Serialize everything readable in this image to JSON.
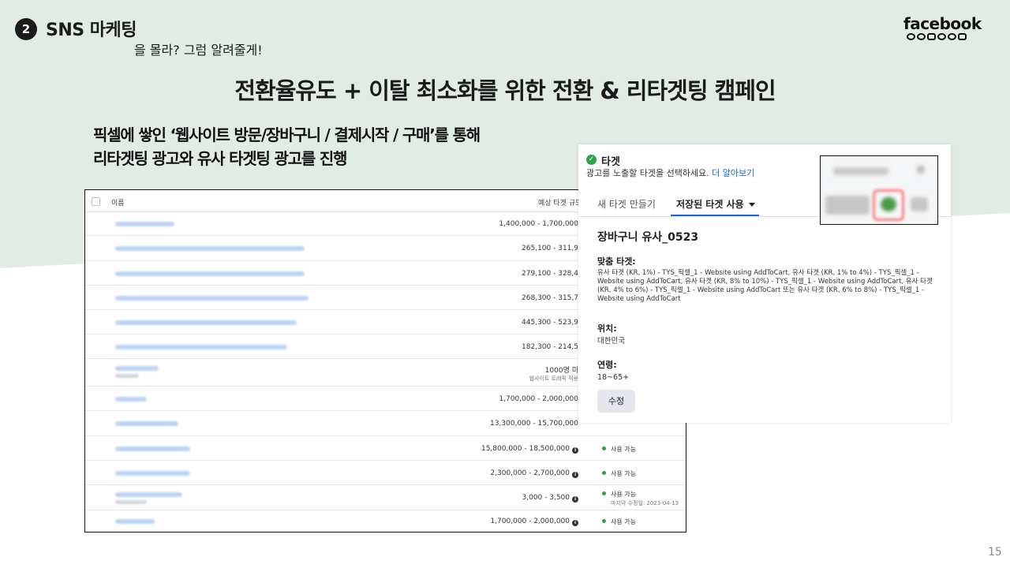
{
  "header": {
    "section_number": "2",
    "section_title": "SNS 마케팅",
    "section_subtitle": "을 몰라? 그럼 알려줄게!",
    "brand": "facebook",
    "brand_icons": [
      "facebook-icon",
      "messenger-icon",
      "instagram-icon",
      "whatsapp-icon",
      "oculus-icon",
      "portal-icon"
    ]
  },
  "main": {
    "heading": "전환율유도 + 이탈 최소화를 위한 전환 & 리타겟팅 캠페인",
    "desc_line1": "픽셀에 쌓인 ‘웹사이트 방문/장바구니 / 결제시작 / 구매’를 통해",
    "desc_line2": "리타겟팅 광고와 유사 타겟팅 광고를 진행"
  },
  "table": {
    "col_name": "이름",
    "col_size": "예상 타겟 규모",
    "rows": [
      {
        "range": "1,400,000 - 1,700,000",
        "info": false,
        "sub": "",
        "status": "",
        "status_sub": ""
      },
      {
        "range": "265,100 - 311,9",
        "info": false,
        "sub": "",
        "status": "",
        "status_sub": ""
      },
      {
        "range": "279,100 - 328,4",
        "info": false,
        "sub": "",
        "status": "",
        "status_sub": ""
      },
      {
        "range": "268,300 - 315,7",
        "info": false,
        "sub": "",
        "status": "",
        "status_sub": ""
      },
      {
        "range": "445,300 - 523,9",
        "info": false,
        "sub": "",
        "status": "",
        "status_sub": ""
      },
      {
        "range": "182,300 - 214,5",
        "info": false,
        "sub": "",
        "status": "",
        "status_sub": ""
      },
      {
        "range": "1000명 미",
        "info": false,
        "sub": "웹사이트 트래픽 적용",
        "status": "",
        "status_sub": ""
      },
      {
        "range": "1,700,000 - 2,000,000",
        "info": false,
        "sub": "",
        "status": "",
        "status_sub": ""
      },
      {
        "range": "13,300,000 - 15,700,000",
        "info": false,
        "sub": "",
        "status": "",
        "status_sub": ""
      },
      {
        "range": "15,800,000 - 18,500,000",
        "info": true,
        "sub": "",
        "status": "사용 가능",
        "status_sub": ""
      },
      {
        "range": "2,300,000 - 2,700,000",
        "info": true,
        "sub": "",
        "status": "사용 가능",
        "status_sub": ""
      },
      {
        "range": "3,000 - 3,500",
        "info": true,
        "sub": "",
        "status": "사용 가능",
        "status_sub": "마지막 수정일: 2023-04-13"
      },
      {
        "range": "1,700,000 - 2,000,000",
        "info": true,
        "sub": "",
        "status": "사용 가능",
        "status_sub": ""
      }
    ]
  },
  "panel": {
    "title": "타겟",
    "subtitle": "광고를 노출할 타겟을 선택하세요.",
    "learn_more": "더 알아보기",
    "tab_new": "새 타겟 만들기",
    "tab_saved": "저장된 타겟 사용",
    "audience_name": "장바구니 유사_0523",
    "custom_label": "맞춤 타겟:",
    "custom_value": "유사 타겟 (KR, 1%) - TYS_픽셀_1 - Website using AddToCart, 유사 타겟 (KR, 1% to 4%) - TYS_픽셀_1 - Website using AddToCart, 유사 타겟 (KR, 8% to 10%) - TYS_픽셀_1 - Website using AddToCart, 유사 타겟 (KR, 4% to 6%) - TYS_픽셀_1 - Website using AddToCart 또는 유사 타겟 (KR, 6% to 8%) - TYS_픽셀_1 - Website using AddToCart",
    "location_label": "위치:",
    "location_value": "대한민국",
    "age_label": "연령:",
    "age_value": "18~65+",
    "edit_label": "수정"
  },
  "page_number": "15",
  "colors": {
    "band": "#e2ece4",
    "link": "#1a66d9",
    "status_green": "#2e9e4f",
    "check_green": "#31a24c"
  }
}
